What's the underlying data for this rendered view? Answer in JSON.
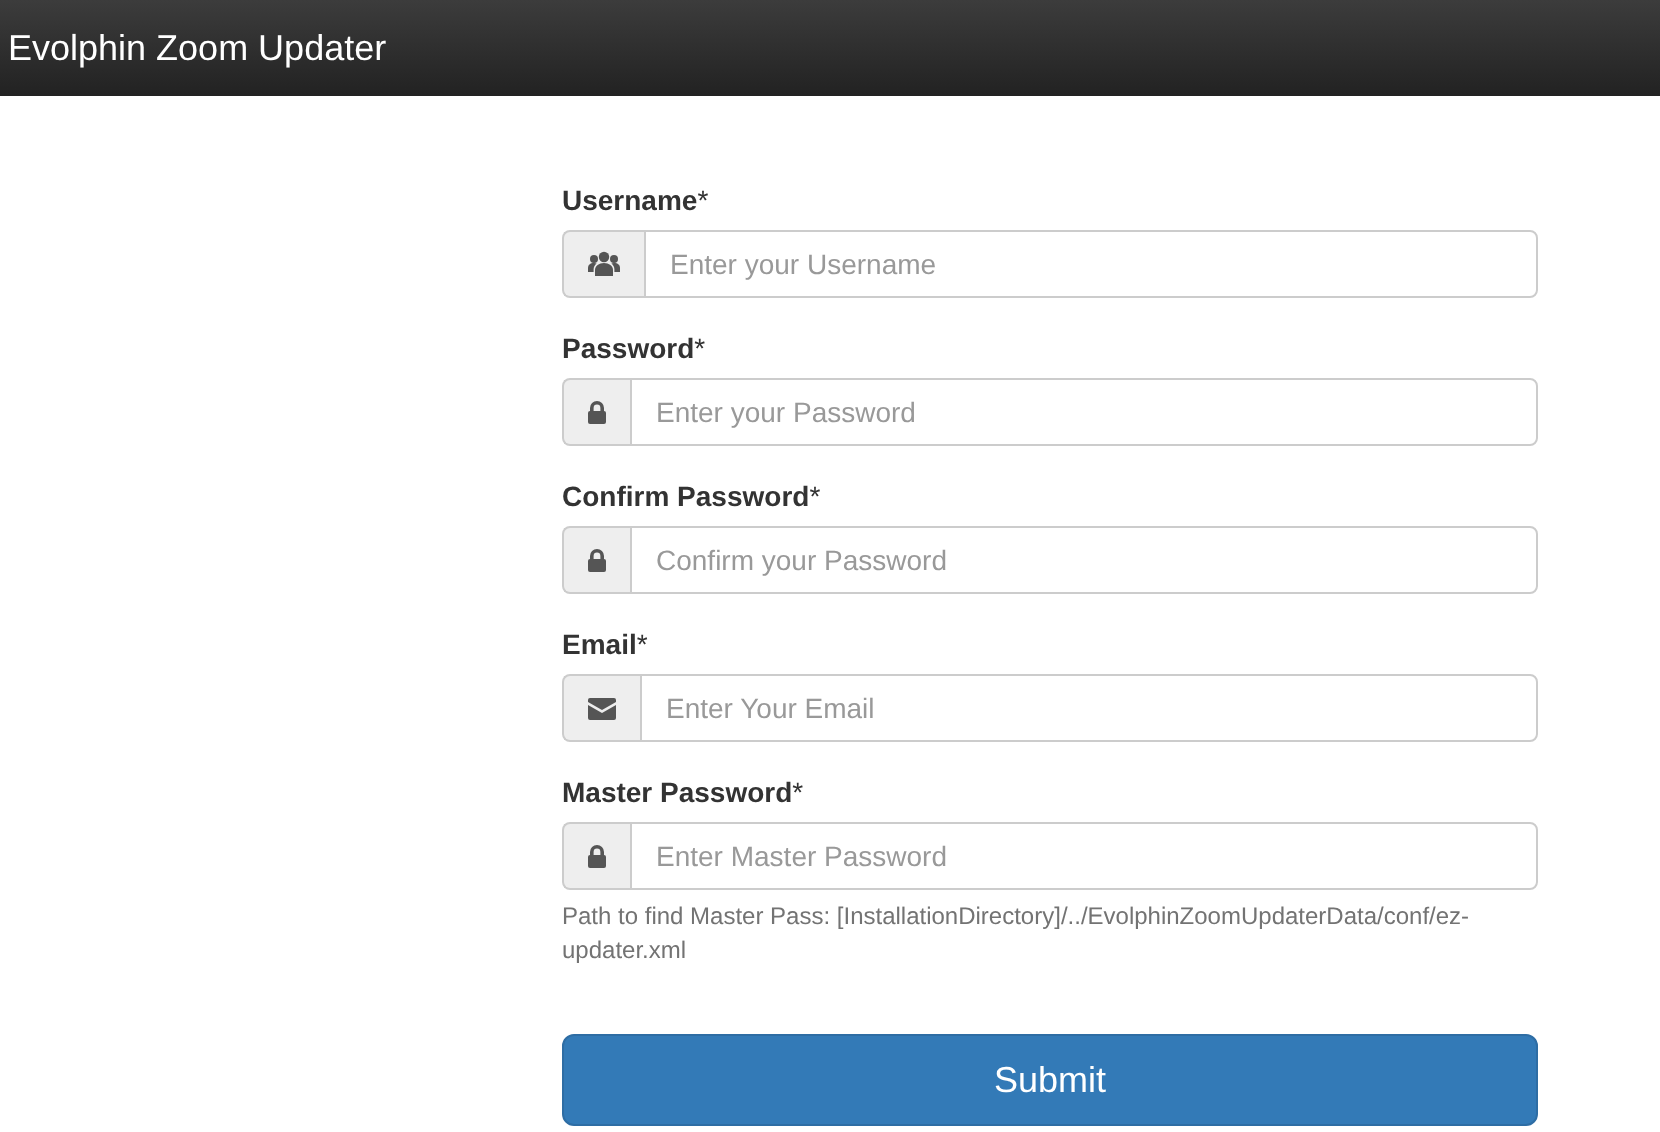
{
  "window": {
    "title": "Evolphin Zoom Updater"
  },
  "fields": [
    {
      "label": "Username",
      "required_mark": "*",
      "kind": "user",
      "placeholder": "Enter your Username"
    },
    {
      "label": "Password",
      "required_mark": "*",
      "kind": "password",
      "placeholder": "Enter your Password"
    },
    {
      "label": "Confirm Password",
      "required_mark": "*",
      "kind": "password",
      "placeholder": "Confirm your Password"
    },
    {
      "label": "Email",
      "required_mark": "*",
      "kind": "email",
      "placeholder": "Enter Your Email"
    },
    {
      "label": "Master Password",
      "required_mark": "*",
      "kind": "password",
      "placeholder": "Enter Master Password",
      "help": "Path to find Master Pass: [InstallationDirectory]/../EvolphinZoomUpdaterData/conf/ez-updater.xml"
    }
  ],
  "submit": "Submit"
}
